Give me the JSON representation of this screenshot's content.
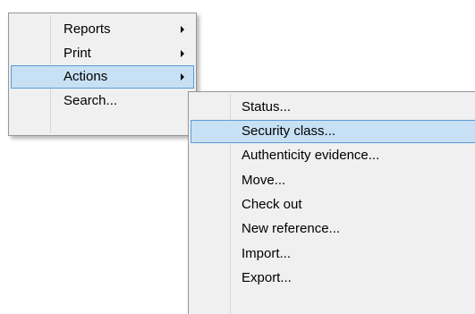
{
  "main_menu": {
    "items": [
      {
        "label": "Reports",
        "has_submenu": true
      },
      {
        "label": "Print",
        "has_submenu": true
      },
      {
        "label": "Actions",
        "has_submenu": true,
        "highlighted": true
      },
      {
        "label": "Search...",
        "has_submenu": false
      }
    ]
  },
  "actions_submenu": {
    "items": [
      {
        "label": "Status..."
      },
      {
        "label": "Security class...",
        "highlighted": true
      },
      {
        "label": "Authenticity evidence..."
      },
      {
        "label": "Move..."
      },
      {
        "label": "Check out"
      },
      {
        "label": "New reference..."
      },
      {
        "label": "Import..."
      },
      {
        "label": "Export..."
      }
    ]
  },
  "colors": {
    "menu_background": "#f0f0f0",
    "highlight_background": "#c7e0f4",
    "highlight_border": "#5b9ad6"
  },
  "icons": {
    "submenu_arrow": "triangle-right-icon"
  }
}
